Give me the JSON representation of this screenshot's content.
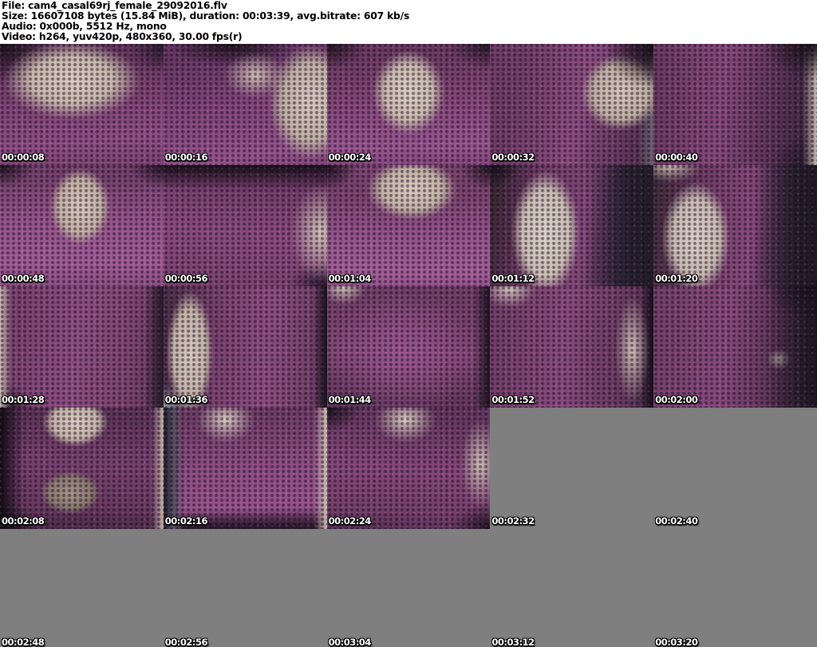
{
  "header": {
    "lines": [
      "File: cam4_casal69rj_female_29092016.flv",
      "Size: 16607108 bytes (15.84 MiB), duration: 00:03:39, avg.bitrate: 607 kb/s",
      "Audio: 0x000b, 5512 Hz, mono",
      "Video: h264, yuv420p, 480x360, 30.00 fps(r)"
    ]
  },
  "palette": {
    "page_bg": "#ffffff",
    "header_text": "#000000",
    "placeholder_gray": "#7f7f7f",
    "timestamp_text": "#ffffff",
    "timestamp_outline": "#000000",
    "dress_magenta": "#8d4f83",
    "skin_tone": "#cfc3b8",
    "dark_background": "#1a141a",
    "wall_gray": "#6e6a73"
  },
  "grid": {
    "columns": 5,
    "rows": 5,
    "interval_seconds": 8,
    "speckle": "radial-gradient(circle at 3px 2px, rgba(24,6,28,0.50) 1.4px, rgba(24,6,28,0) 2.6px) 0 0 / 7px 6px, radial-gradient(circle at 1px 4px, rgba(228,150,210,0.16) 1px, rgba(228,150,210,0) 2px) 0 0 / 9px 8px",
    "thumbs": [
      {
        "time": "00:00:08",
        "bg": "radial-gradient(ellipse 60% 46% at 44% 30%, #d8cdc2 0%, #c5b7aa 42%, rgba(197,183,170,0) 70%), radial-gradient(ellipse 46% 46% at 0% 0%, #18121a 0%, rgba(24,18,26,0) 72%), radial-gradient(ellipse 30% 32% at 100% 2%, #251b28 0%, rgba(37,27,40,0) 70%), linear-gradient(176deg, #5e3459 6%, #7c4373 45%, #8e5085 78%, #7a4371 100%)"
      },
      {
        "time": "00:00:16",
        "bg": "radial-gradient(ellipse 36% 66% at 90% 48%, #d5c9be 0%, #beb0a3 48%, rgba(190,176,163,0) 72%), radial-gradient(ellipse 28% 28% at 56% 26%, #ccbeb1 0%, rgba(204,190,177,0) 68%), radial-gradient(ellipse 52% 26% at 42% 0%, #191319 0%, rgba(25,19,25,0) 74%), linear-gradient(172deg, #633762 8%, #81467a 50%, #93548b 86%, #7e4576 100%)"
      },
      {
        "time": "00:00:24",
        "bg": "radial-gradient(ellipse 32% 50% at 50% 40%, #dad0c5 0%, #c8baad 45%, rgba(200,186,173,0) 70%), radial-gradient(ellipse 34% 30% at 0% 0%, #1a141c 0%, rgba(26,20,28,0) 70%), radial-gradient(ellipse 34% 30% at 100% 0%, #1f1722 0%, rgba(31,23,34,0) 70%), linear-gradient(178deg, #68395f 8%, #86497c 52%, #965790 84%, #82467a 100%)"
      },
      {
        "time": "00:00:32",
        "bg": "radial-gradient(ellipse 42% 46% at 100% 4%, #120e13 0%, rgba(18,14,19,0) 70%), radial-gradient(ellipse 34% 44% at 80% 40%, #d2c6ba 0%, #bcaea1 50%, rgba(188,174,161,0) 72%), linear-gradient(270deg, #6b6770 0%, rgba(107,103,112,0) 10%), linear-gradient(102deg, #6f3d67 18%, #8a4d80 55%, #5a3457 88%, #472c48 100%)"
      },
      {
        "time": "00:00:40",
        "bg": "radial-gradient(ellipse 42% 42% at 96% 0%, #151015 0%, rgba(21,16,21,0) 70%), linear-gradient(270deg, #c9bcb1 0%, rgba(201,188,177,0) 9%), radial-gradient(ellipse 40% 36% at 100% 100%, #201825 0%, rgba(32,24,37,0) 72%), linear-gradient(96deg, #6a3a63 4%, #85487b 42%, #4e2f4d 82%, #2e2233 100%)"
      },
      {
        "time": "00:00:48",
        "bg": "radial-gradient(ellipse 26% 44% at 49% 34%, #d5c8bc 0%, #c1b1a3 50%, rgba(193,177,163,0) 72%), radial-gradient(ellipse 30% 26% at 0% 0%, #171219 0%, rgba(23,18,25,0) 70%), radial-gradient(ellipse 30% 26% at 100% 0%, #1c1520 0%, rgba(28,21,32,0) 70%), linear-gradient(180deg, #72406a 6%, #94548b 46%, #a05d96 80%, #8b5083 100%)"
      },
      {
        "time": "00:00:56",
        "bg": "radial-gradient(ellipse 26% 58% at 96% 56%, #cec1b5 0%, rgba(206,193,181,0) 70%), linear-gradient(180deg, #171118 0%, rgba(23,17,24,0) 20%), radial-gradient(ellipse 34% 30% at 100% 100%, #221627 0%, rgba(34,22,39,0) 70%), linear-gradient(186deg, #6c3b65 14%, #894b7f 55%, #78426f 100%)"
      },
      {
        "time": "00:01:04",
        "bg": "radial-gradient(ellipse 40% 36% at 52% 20%, #d7cbbf 0%, #c2b3a5 46%, rgba(194,179,165,0) 70%), radial-gradient(ellipse 26% 26% at 0% 2%, #181219 0%, rgba(24,18,25,0) 70%), radial-gradient(ellipse 26% 26% at 100% 2%, #1d1620 0%, rgba(29,22,32,0) 70%), linear-gradient(180deg, #79436e 24%, #985790 64%, #a35f98 90%, #91528a 100%)"
      },
      {
        "time": "00:01:12",
        "bg": "radial-gradient(ellipse 30% 74% at 34% 56%, #dbd1c7 0%, #c9beb3 48%, rgba(201,190,179,0) 70%), radial-gradient(ellipse 24% 22% at 2% 2%, #16121a 0%, rgba(22,18,26,0) 70%), linear-gradient(270deg, #211e28 0%, #262231 16%, rgba(38,34,49,0) 42%), radial-gradient(ellipse 28% 24% at 96% 90%, #6e6a73 0%, rgba(110,106,115,0) 68%), linear-gradient(100deg, #30242c 0%, #6c3b64 28%, #83487a 58%, #433047 84%, #2a2432 100%)"
      },
      {
        "time": "00:01:20",
        "bg": "radial-gradient(ellipse 30% 66% at 26% 60%, #d9cfc5 0%, #c6bab0 48%, rgba(198,186,176,0) 70%), radial-gradient(ellipse 30% 22% at 10% 0%, #cabdb2 0%, rgba(202,189,178,0) 66%), linear-gradient(270deg, #1d1a24 0%, #24202c 14%, rgba(36,32,44,0) 40%), radial-gradient(ellipse 26% 22% at 100% 96%, #57535c 0%, rgba(87,83,92,0) 68%), linear-gradient(98deg, #3a2a36 0%, #6f3d66 30%, #86497c 60%, #4a2f4b 88%, #2d2533 100%)"
      },
      {
        "time": "00:01:28",
        "bg": "linear-gradient(90deg, #c8bbaf 0%, rgba(200,187,175,0) 7%), radial-gradient(ellipse 30% 30% at 0% 100%, #151118 0%, rgba(21,17,24,0) 70%), linear-gradient(270deg, #241b28 0%, rgba(36,27,40,0) 12%), linear-gradient(100deg, #7a4270 12%, #8c4f82 48%, #7b446f 78%, #5f3659 100%)"
      },
      {
        "time": "00:01:36",
        "bg": "radial-gradient(ellipse 20% 72% at 16% 55%, #d4c9be 0%, #c1b3a7 50%, rgba(193,179,167,0) 72%), radial-gradient(ellipse 24% 26% at 0% 98%, #8da0a0 0%, rgba(141,160,160,0) 64%), linear-gradient(270deg, #141119 0%, rgba(20,17,25,0) 9%), linear-gradient(94deg, #4c3049 2%, #7c4472 36%, #8b4e81 64%, #693b61 100%)"
      },
      {
        "time": "00:01:44",
        "bg": "radial-gradient(ellipse 22% 24% at 10% 0%, #d1c5b9 0%, rgba(209,197,185,0) 64%), linear-gradient(270deg, #18141c 0%, rgba(24,20,28,0) 10%), radial-gradient(ellipse 58% 70% at 46% 55%, #99568f 0%, rgba(153,86,143,0) 75%), linear-gradient(182deg, #6f3e66 10%, #834879 55%, #5f3658 100%)"
      },
      {
        "time": "00:01:52",
        "bg": "radial-gradient(ellipse 24% 24% at 12% 2%, #cfc3b8 0%, rgba(207,195,184,0) 66%), radial-gradient(ellipse 15% 64% at 87% 52%, #cdc0b5 0%, rgba(205,192,181,0) 70%), linear-gradient(270deg, #130f17 0%, rgba(19,15,23,0) 8%), linear-gradient(96deg, #713f68 8%, #884b7e 46%, #62385b 84%, #3f2a42 100%)"
      },
      {
        "time": "00:02:00",
        "bg": "radial-gradient(ellipse 46% 40% at 100% 0%, #171320 0%, rgba(23,19,32,0) 70%), linear-gradient(270deg, #1b1722 0%, rgba(27,23,34,0) 32%), radial-gradient(ellipse 11% 13% at 77% 60%, #bfb1a5 0%, rgba(191,177,165,0) 68%), radial-gradient(ellipse 24% 18% at 100% 100%, #59555e 0%, rgba(89,85,94,0) 66%), linear-gradient(96deg, #73406a 4%, #86497c 44%, #53314f 80%, #342739 100%)"
      },
      {
        "time": "00:02:08",
        "bg": "linear-gradient(90deg, #0f0c12 0%, rgba(15,12,18,0) 15%), radial-gradient(ellipse 28% 28% at 46% 12%, #d6cabf 0%, #c2b4a7 50%, rgba(194,180,167,0) 72%), radial-gradient(ellipse 25% 24% at 43% 70%, #a3948a 0%, #887a6f 52%, rgba(136,122,111,0) 74%), linear-gradient(270deg, #c4b7ab 0%, rgba(196,183,171,0) 7%), radial-gradient(ellipse 34% 30% at 0% 100%, #140f16 0%, rgba(20,15,22,0) 70%), linear-gradient(182deg, #5c3457 8%, #784270 45%, #693a60 80%, #492c45 100%)"
      },
      {
        "time": "00:02:16",
        "bg": "linear-gradient(90deg, #211e29 0%, #555261 6%, rgba(85,82,97,0) 13%), radial-gradient(ellipse 26% 28% at 38% 10%, #d4c8bd 0%, rgba(212,200,189,0) 68%), linear-gradient(270deg, #ccc0b5 0%, rgba(204,192,181,0) 8%), linear-gradient(0deg, #231525 0%, rgba(35,21,37,0) 16%), linear-gradient(176deg, #6d3c66 8%, #8c4e82 48%, #96548b 80%, #6e3c65 100%)"
      },
      {
        "time": "00:02:24",
        "bg": "radial-gradient(ellipse 30% 30% at 0% 0%, #141016 0%, rgba(20,16,22,0) 70%), radial-gradient(ellipse 28% 28% at 48% 10%, #d5c9be 0%, rgba(213,201,190,0) 68%), radial-gradient(ellipse 17% 52% at 94% 46%, #c9bcb1 0%, rgba(201,188,177,0) 70%), radial-gradient(ellipse 34% 30% at 100% 100%, #1c1320 0%, rgba(28,19,32,0) 70%), linear-gradient(184deg, #643861 10%, #85487b 50%, #74406b 84%, #533051 100%)"
      },
      {
        "time": "00:02:32",
        "bg": null
      },
      {
        "time": "00:02:40",
        "bg": null
      },
      {
        "time": "00:02:48",
        "bg": null
      },
      {
        "time": "00:02:56",
        "bg": null
      },
      {
        "time": "00:03:04",
        "bg": null
      },
      {
        "time": "00:03:12",
        "bg": null
      },
      {
        "time": "00:03:20",
        "bg": null
      }
    ]
  }
}
